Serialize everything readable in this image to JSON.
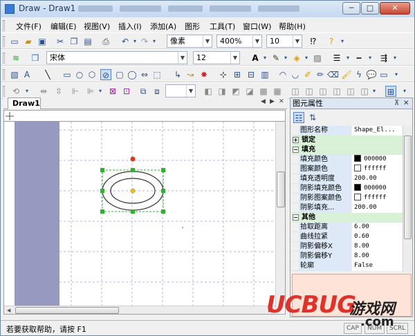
{
  "window": {
    "title": "Draw - Draw1"
  },
  "window_controls": {
    "minimize": "─",
    "maximize": "□",
    "close": "✕"
  },
  "menu": [
    {
      "label": "文件(F)"
    },
    {
      "label": "编辑(E)"
    },
    {
      "label": "视图(V)"
    },
    {
      "label": "插入(I)"
    },
    {
      "label": "添加(A)"
    },
    {
      "label": "图形"
    },
    {
      "label": "工具(T)"
    },
    {
      "label": "窗口(W)"
    },
    {
      "label": "帮助(H)"
    }
  ],
  "toolbar": {
    "unit_combo": "像素",
    "zoom_combo": "400%",
    "size_combo": "10",
    "font_combo": "宋体",
    "font_size_combo": "12"
  },
  "document": {
    "tab_label": "Draw1"
  },
  "properties_panel": {
    "title": "图元属性",
    "header_row": {
      "name": "图形名称",
      "value": "Shape_El..."
    },
    "categories": [
      {
        "label": "锁定",
        "expander": "+",
        "rows": []
      },
      {
        "label": "填充",
        "expander": "−",
        "rows": [
          {
            "name": "填充颜色",
            "value": "000000",
            "swatch": "#000000"
          },
          {
            "name": "图案颜色",
            "value": "ffffff",
            "swatch": "#ffffff"
          },
          {
            "name": "填充透明度",
            "value": "200.00"
          },
          {
            "name": "阴影填充颜色",
            "value": "000000",
            "swatch": "#000000"
          },
          {
            "name": "阴影图案颜色",
            "value": "ffffff",
            "swatch": "#ffffff"
          },
          {
            "name": "阴影填充...",
            "value": "200.00"
          }
        ]
      },
      {
        "label": "其他",
        "expander": "−",
        "rows": [
          {
            "name": "拾取距离",
            "value": "6.00"
          },
          {
            "name": "曲线拉紧",
            "value": "0.60"
          },
          {
            "name": "阴影偏移X",
            "value": "8.00"
          },
          {
            "name": "阴影偏移Y",
            "value": "8.00"
          },
          {
            "name": "轮廓",
            "value": "False"
          }
        ]
      }
    ]
  },
  "status": {
    "text": "若要获取帮助，请按 F1",
    "caps": "CAP",
    "num": "NUM",
    "scrl": "SCRL"
  },
  "watermark": {
    "brand": "UCBUG",
    "site": "游戏网",
    "domain": ".com"
  },
  "colors": {
    "accent": "#2a4f8a",
    "selection_handle": "#2fb32f",
    "rotate_handle": "#d63a1a",
    "center_point": "#f0c020",
    "margin_strip": "#9899c1"
  }
}
